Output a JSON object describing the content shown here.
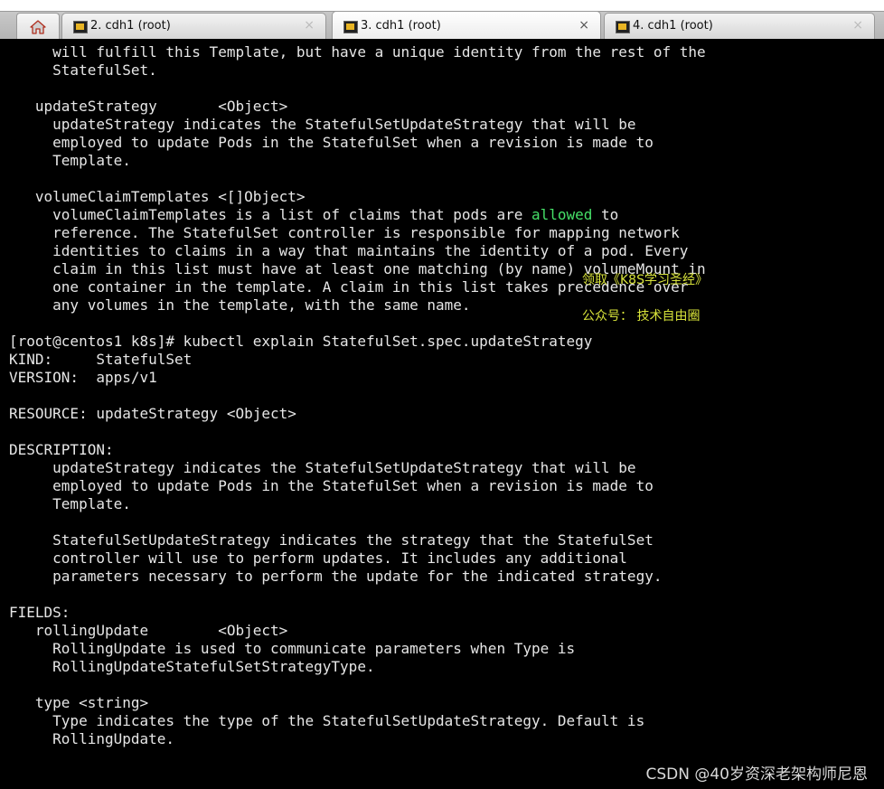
{
  "tabs": [
    {
      "label": "2. cdh1 (root)",
      "close": "×",
      "active": false
    },
    {
      "label": "3. cdh1 (root)",
      "close": "×",
      "active": true
    },
    {
      "label": "4. cdh1 (root)",
      "close": "×",
      "active": false
    }
  ],
  "terminal": {
    "lines": [
      "     will fulfill this Template, but have a unique identity from the rest of the",
      "     StatefulSet.",
      "",
      "   updateStrategy       <Object>",
      "     updateStrategy indicates the StatefulSetUpdateStrategy that will be",
      "     employed to update Pods in the StatefulSet when a revision is made to",
      "     Template.",
      "",
      "   volumeClaimTemplates <[]Object>",
      "     volumeClaimTemplates is a list of claims that pods are allowed to",
      "     reference. The StatefulSet controller is responsible for mapping network",
      "     identities to claims in a way that maintains the identity of a pod. Every",
      "     claim in this list must have at least one matching (by name) volumeMount in",
      "     one container in the template. A claim in this list takes precedence over",
      "     any volumes in the template, with the same name.",
      "",
      "[root@centos1 k8s]# kubectl explain StatefulSet.spec.updateStrategy",
      "KIND:     StatefulSet",
      "VERSION:  apps/v1",
      "",
      "RESOURCE: updateStrategy <Object>",
      "",
      "DESCRIPTION:",
      "     updateStrategy indicates the StatefulSetUpdateStrategy that will be",
      "     employed to update Pods in the StatefulSet when a revision is made to",
      "     Template.",
      "",
      "     StatefulSetUpdateStrategy indicates the strategy that the StatefulSet",
      "     controller will use to perform updates. It includes any additional",
      "     parameters necessary to perform the update for the indicated strategy.",
      "",
      "FIELDS:",
      "   rollingUpdate        <Object>",
      "     RollingUpdate is used to communicate parameters when Type is",
      "     RollingUpdateStatefulSetStrategyType.",
      "",
      "   type <string>",
      "     Type indicates the type of the StatefulSetUpdateStrategy. Default is",
      "     RollingUpdate."
    ],
    "highlight_word": "allowed",
    "highlight_color": "#46e068",
    "text_color": "#e6e6e6",
    "background": "#000000"
  },
  "watermark": {
    "line1": "领取《K8S学习圣经》",
    "line2": "公众号：  技术自由圈",
    "color": "#d8e33a"
  },
  "footer": {
    "csdn": "CSDN @40岁资深老架构师尼恩"
  },
  "icons": {
    "home": "home-icon",
    "putty": "putty-icon"
  }
}
